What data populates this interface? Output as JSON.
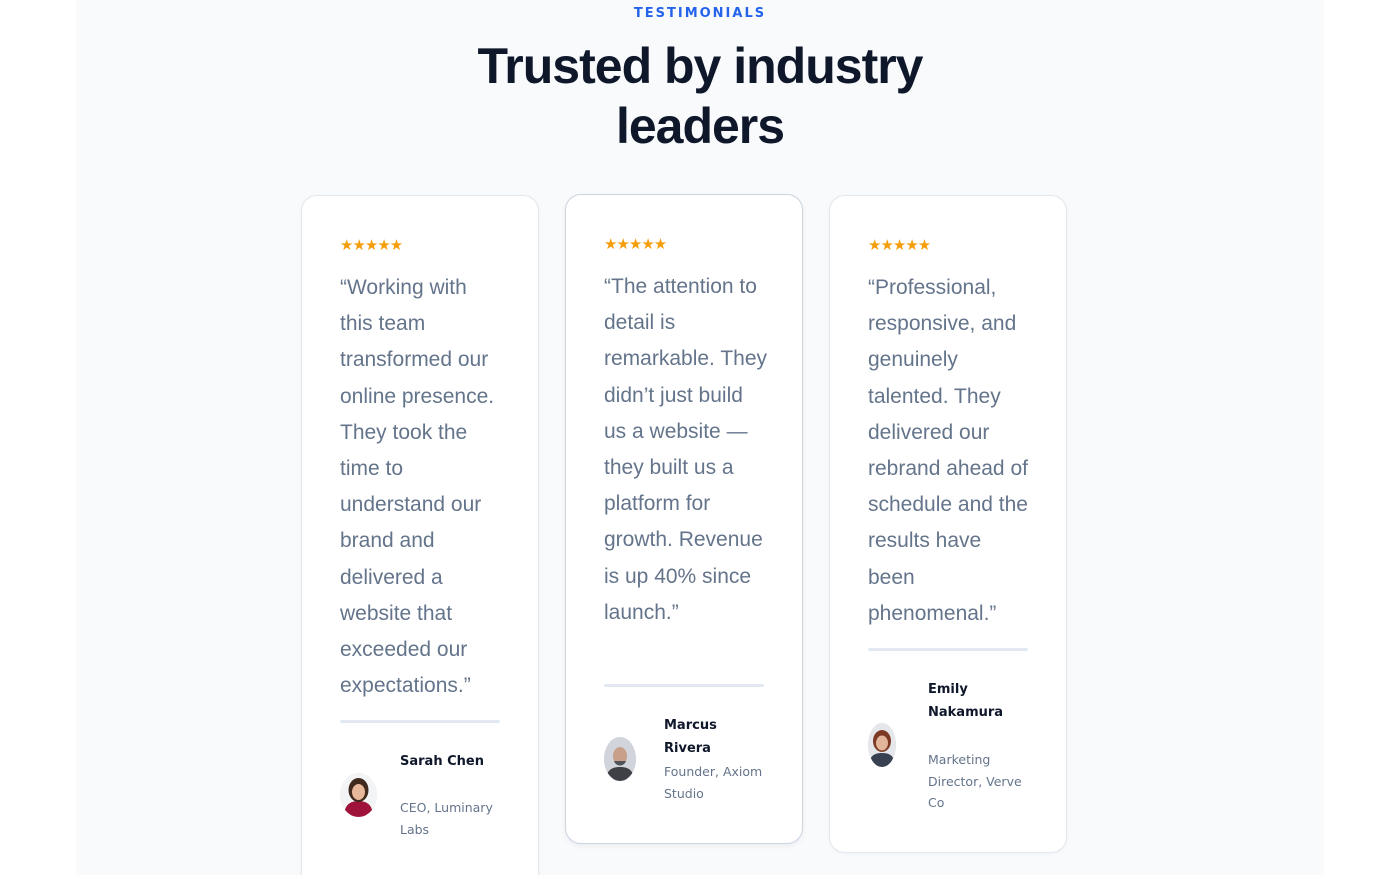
{
  "section": {
    "eyebrow": "TESTIMONIALS",
    "headline_line1": "Trusted by industry",
    "headline_line2": "leaders"
  },
  "colors": {
    "accent": "#2563eb",
    "star": "#f59e0b",
    "heading": "#0f172a",
    "body_text": "#64748b",
    "card_border": "#e2e8f0",
    "section_bg": "#f8fafc"
  },
  "testimonials": [
    {
      "rating": 5,
      "stars": "★★★★★",
      "quote": "“Working with this team transformed our online presence. They took the time to understand our brand and delivered a website that exceeded our expectations.”",
      "name": "Sarah Chen",
      "role": "CEO, Luminary Labs",
      "avatar_icon": "avatar-sarah"
    },
    {
      "rating": 5,
      "stars": "★★★★★",
      "quote": "“The attention to detail is remarkable. They didn’t just build us a website — they built us a platform for growth. Revenue is up 40% since launch.”",
      "name": "Marcus Rivera",
      "role": "Founder, Axiom Studio",
      "avatar_icon": "avatar-marcus"
    },
    {
      "rating": 5,
      "stars": "★★★★★",
      "quote": "“Professional, responsive, and genuinely talented. They delivered our rebrand ahead of schedule and the results have been phenomenal.”",
      "name": "Emily Nakamura",
      "role": "Marketing Director, Verve Co",
      "avatar_icon": "avatar-emily"
    }
  ]
}
